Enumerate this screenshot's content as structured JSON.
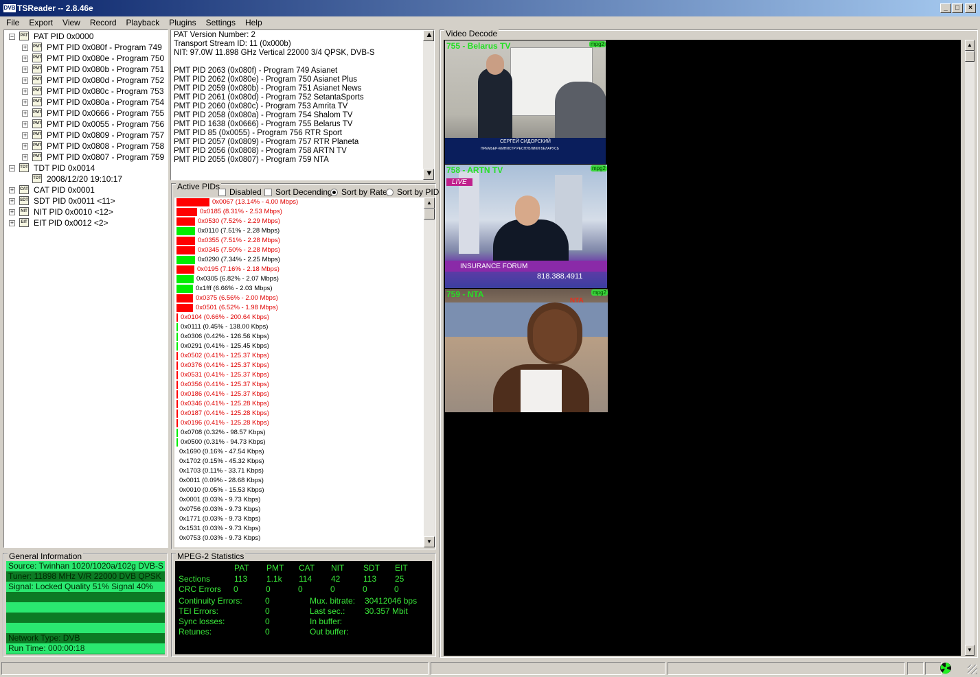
{
  "app": {
    "title": "TSReader -- 2.8.46e",
    "logo": "DVB",
    "min": "_",
    "max": "□",
    "close": "×"
  },
  "menu": [
    "File",
    "Export",
    "View",
    "Record",
    "Playback",
    "Plugins",
    "Settings",
    "Help"
  ],
  "tree": [
    {
      "label": "PAT PID 0x0000",
      "level": 0,
      "expander": "−",
      "icon": "PAT"
    },
    {
      "label": "PMT PID 0x080f - Program 749",
      "level": 1,
      "expander": "+",
      "icon": "PMT"
    },
    {
      "label": "PMT PID 0x080e - Program 750",
      "level": 1,
      "expander": "+",
      "icon": "PMT"
    },
    {
      "label": "PMT PID 0x080b - Program 751",
      "level": 1,
      "expander": "+",
      "icon": "PMT"
    },
    {
      "label": "PMT PID 0x080d - Program 752",
      "level": 1,
      "expander": "+",
      "icon": "PMT"
    },
    {
      "label": "PMT PID 0x080c - Program 753",
      "level": 1,
      "expander": "+",
      "icon": "PMT"
    },
    {
      "label": "PMT PID 0x080a - Program 754",
      "level": 1,
      "expander": "+",
      "icon": "PMT"
    },
    {
      "label": "PMT PID 0x0666 - Program 755",
      "level": 1,
      "expander": "+",
      "icon": "PMT"
    },
    {
      "label": "PMT PID 0x0055 - Program 756",
      "level": 1,
      "expander": "+",
      "icon": "PMT"
    },
    {
      "label": "PMT PID 0x0809 - Program 757",
      "level": 1,
      "expander": "+",
      "icon": "PMT"
    },
    {
      "label": "PMT PID 0x0808 - Program 758",
      "level": 1,
      "expander": "+",
      "icon": "PMT"
    },
    {
      "label": "PMT PID 0x0807 - Program 759",
      "level": 1,
      "expander": "+",
      "icon": "PMT"
    },
    {
      "label": "TDT PID 0x0014",
      "level": 0,
      "expander": "−",
      "icon": "TDT"
    },
    {
      "label": "2008/12/20 19:10:17",
      "level": 1,
      "expander": "",
      "icon": "TDT"
    },
    {
      "label": "CAT PID 0x0001",
      "level": 0,
      "expander": "+",
      "icon": "CAT"
    },
    {
      "label": "SDT PID 0x0011 <11>",
      "level": 0,
      "expander": "+",
      "icon": "SDT"
    },
    {
      "label": "NIT PID 0x0010 <12>",
      "level": 0,
      "expander": "+",
      "icon": "NIT"
    },
    {
      "label": "EIT PID 0x0012 <2>",
      "level": 0,
      "expander": "+",
      "icon": "EIT"
    }
  ],
  "pat_info": [
    "PAT Version Number: 2",
    "Transport Stream ID: 11 (0x000b)",
    "NIT: 97.0W 11.898 GHz Vertical 22000 3/4 QPSK, DVB-S",
    "",
    "PMT PID 2063 (0x080f) - Program 749 Asianet",
    "PMT PID 2062 (0x080e) - Program 750 Asianet Plus",
    "PMT PID 2059 (0x080b) - Program 751 Asianet News",
    "PMT PID 2061 (0x080d) - Program 752 SetantaSports",
    "PMT PID 2060 (0x080c) - Program 753 Amrita TV",
    "PMT PID 2058 (0x080a) - Program 754 Shalom TV",
    "PMT PID 1638 (0x0666) - Program 755 Belarus TV",
    "PMT PID 85 (0x0055) - Program 756 RTR Sport",
    "PMT PID 2057 (0x0809) - Program 757 RTR Planeta",
    "PMT PID 2056 (0x0808) - Program 758 ARTN TV",
    "PMT PID 2055 (0x0807) - Program 759 NTA"
  ],
  "active_pids": {
    "title": "Active PIDs",
    "options": {
      "disabled": "Disabled",
      "sort_desc": "Sort Decending",
      "sort_rate": "Sort by Rate",
      "sort_pid": "Sort by PID"
    },
    "rows": [
      {
        "text": "0x0067 (13.14% - 4.00 Mbps)",
        "percent": 13.14,
        "color": "red"
      },
      {
        "text": "0x0185 (8.31% - 2.53 Mbps)",
        "percent": 8.31,
        "color": "red"
      },
      {
        "text": "0x0530 (7.52% - 2.29 Mbps)",
        "percent": 7.52,
        "color": "red"
      },
      {
        "text": "0x0110 (7.51% - 2.28 Mbps)",
        "percent": 7.51,
        "color": "green"
      },
      {
        "text": "0x0355 (7.51% - 2.28 Mbps)",
        "percent": 7.51,
        "color": "red"
      },
      {
        "text": "0x0345 (7.50% - 2.28 Mbps)",
        "percent": 7.5,
        "color": "red"
      },
      {
        "text": "0x0290 (7.34% - 2.25 Mbps)",
        "percent": 7.34,
        "color": "green"
      },
      {
        "text": "0x0195 (7.16% - 2.18 Mbps)",
        "percent": 7.16,
        "color": "red"
      },
      {
        "text": "0x0305 (6.82% - 2.07 Mbps)",
        "percent": 6.82,
        "color": "green"
      },
      {
        "text": "0x1fff (6.66% - 2.03 Mbps)",
        "percent": 6.66,
        "color": "green"
      },
      {
        "text": "0x0375 (6.56% - 2.00 Mbps)",
        "percent": 6.56,
        "color": "red"
      },
      {
        "text": "0x0501 (6.52% - 1.98 Mbps)",
        "percent": 6.52,
        "color": "red"
      },
      {
        "text": "0x0104 (0.66% - 200.64 Kbps)",
        "percent": 0.66,
        "color": "red"
      },
      {
        "text": "0x0111 (0.45% - 138.00 Kbps)",
        "percent": 0.45,
        "color": "green"
      },
      {
        "text": "0x0306 (0.42% - 126.56 Kbps)",
        "percent": 0.42,
        "color": "green"
      },
      {
        "text": "0x0291 (0.41% - 125.45 Kbps)",
        "percent": 0.41,
        "color": "green"
      },
      {
        "text": "0x0502 (0.41% - 125.37 Kbps)",
        "percent": 0.41,
        "color": "red"
      },
      {
        "text": "0x0376 (0.41% - 125.37 Kbps)",
        "percent": 0.41,
        "color": "red"
      },
      {
        "text": "0x0531 (0.41% - 125.37 Kbps)",
        "percent": 0.41,
        "color": "red"
      },
      {
        "text": "0x0356 (0.41% - 125.37 Kbps)",
        "percent": 0.41,
        "color": "red"
      },
      {
        "text": "0x0186 (0.41% - 125.37 Kbps)",
        "percent": 0.41,
        "color": "red"
      },
      {
        "text": "0x0346 (0.41% - 125.28 Kbps)",
        "percent": 0.41,
        "color": "red"
      },
      {
        "text": "0x0187 (0.41% - 125.28 Kbps)",
        "percent": 0.41,
        "color": "red"
      },
      {
        "text": "0x0196 (0.41% - 125.28 Kbps)",
        "percent": 0.41,
        "color": "red"
      },
      {
        "text": "0x0708 (0.32% - 98.57 Kbps)",
        "percent": 0.32,
        "color": "green"
      },
      {
        "text": "0x0500 (0.31% - 94.73 Kbps)",
        "percent": 0.31,
        "color": "green"
      },
      {
        "text": "0x1690 (0.16% - 47.54 Kbps)",
        "percent": 0.16,
        "color": "none"
      },
      {
        "text": "0x1702 (0.15% - 45.32 Kbps)",
        "percent": 0.15,
        "color": "none"
      },
      {
        "text": "0x1703 (0.11% - 33.71 Kbps)",
        "percent": 0.11,
        "color": "none"
      },
      {
        "text": "0x0011 (0.09% - 28.68 Kbps)",
        "percent": 0.09,
        "color": "none"
      },
      {
        "text": "0x0010 (0.05% - 15.53 Kbps)",
        "percent": 0.05,
        "color": "none"
      },
      {
        "text": "0x0001 (0.03% - 9.73 Kbps)",
        "percent": 0.03,
        "color": "none"
      },
      {
        "text": "0x0756 (0.03% - 9.73 Kbps)",
        "percent": 0.03,
        "color": "none"
      },
      {
        "text": "0x1771 (0.03% - 9.73 Kbps)",
        "percent": 0.03,
        "color": "none"
      },
      {
        "text": "0x1531 (0.03% - 9.73 Kbps)",
        "percent": 0.03,
        "color": "none"
      },
      {
        "text": "0x0753 (0.03% - 9.73 Kbps)",
        "percent": 0.03,
        "color": "none"
      }
    ]
  },
  "video": {
    "title": "Video Decode",
    "streams": [
      {
        "label": "755 - Belarus TV",
        "tag": "mpg2",
        "caption": "СЕРГЕЙ СИДОРСКИЙ",
        "subcaption": "ПРЕМЬЕР-МИНИСТР РЕСПУБЛИКИ БЕЛАРУСЬ"
      },
      {
        "label": "758 - ARTN TV",
        "tag": "mpg2",
        "caption": "INSURANCE FORUM",
        "subcaption": "818.388.4911",
        "live": "LIVE"
      },
      {
        "label": "759 - NTA",
        "tag": "mpg2",
        "caption": "",
        "subcaption": ""
      }
    ]
  },
  "general_info": {
    "title": "General Information",
    "rows": [
      "Source: Twinhan 1020/1020a/102g DVB-S",
      "Tuner: 11898 MHz V/R 22000 DVB QPSK",
      "Signal: Locked Quality 51% Signal 40%",
      "",
      "",
      "",
      "",
      "Network Type: DVB",
      "Run Time: 000:00:18"
    ]
  },
  "mpeg2": {
    "title": "MPEG-2 Statistics",
    "headers": [
      "PAT",
      "PMT",
      "CAT",
      "NIT",
      "SDT",
      "EIT"
    ],
    "sections_label": "Sections",
    "sections": [
      "113",
      "1.1k",
      "114",
      "42",
      "113",
      "25"
    ],
    "crc_label": "CRC Errors",
    "crc": [
      "0",
      "0",
      "0",
      "0",
      "0",
      "0"
    ],
    "left_stats": [
      {
        "label": "Continuity Errors:",
        "value": "0"
      },
      {
        "label": "TEI Errors:",
        "value": "0"
      },
      {
        "label": "Sync losses:",
        "value": "0"
      },
      {
        "label": "Retunes:",
        "value": "0"
      }
    ],
    "right_stats": [
      {
        "label": "Mux. bitrate:",
        "value": "30412046 bps"
      },
      {
        "label": "Last sec.:",
        "value": "30.357 Mbit"
      },
      {
        "label": "In buffer:",
        "value": ""
      },
      {
        "label": "Out buffer:",
        "value": ""
      }
    ]
  },
  "colors": {
    "bar_red": "#ff0000",
    "bar_green": "#00ee00",
    "text_red": "#e00000",
    "green_text": "#39e639",
    "gi_light": "#2ae870",
    "gi_dark": "#0c7a24"
  }
}
